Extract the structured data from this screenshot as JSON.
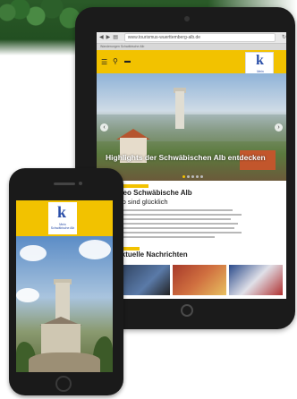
{
  "tablet": {
    "url": "www.tourismus-wuerttemberg-alb.de",
    "tab_text": "Wanderungen Schwäbische Alb",
    "logo_letter": "k",
    "logo_text": "Mein Schwäbische Alb",
    "hero_caption": "Highlights der Schwäbischen Alb entdecken",
    "article_title": "theo Schwäbische Alb",
    "article_subtitle": "Alb sind glücklich",
    "news_heading": "Aktuelle Nachrichten"
  },
  "phone": {
    "logo_letter": "k",
    "logo_text": "Mein Schwäbische Alb"
  },
  "icons": {
    "menu": "hamburger-menu-icon",
    "search": "search-icon",
    "bus": "bus-icon",
    "arrow_left": "chevron-left-icon",
    "arrow_right": "chevron-right-icon"
  },
  "colors": {
    "brand_yellow": "#f2c200",
    "brand_blue": "#2b4fa8"
  }
}
